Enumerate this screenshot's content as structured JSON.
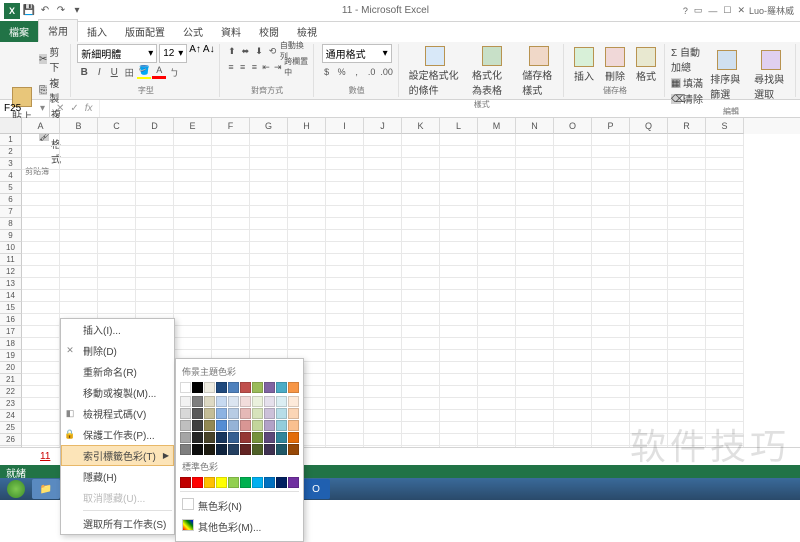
{
  "title": "11 - Microsoft Excel",
  "user": "Luo-羅林威",
  "qat": {
    "save": "H"
  },
  "tabs": {
    "file": "檔案",
    "list": [
      "常用",
      "插入",
      "版面配置",
      "公式",
      "資料",
      "校閱",
      "檢視"
    ],
    "active": 0
  },
  "ribbon": {
    "clipboard": {
      "paste": "貼上",
      "cut": "剪下",
      "copy": "複製",
      "fmtpaint": "複製格式",
      "label": "剪貼簿"
    },
    "font": {
      "name": "新細明體",
      "size": "12",
      "label": "字型"
    },
    "align": {
      "wrap": "自動換列",
      "merge": "跨欄置中",
      "label": "對齊方式"
    },
    "number": {
      "format": "通用格式",
      "label": "數值"
    },
    "styles": {
      "cond": "設定格式化的條件",
      "fmttbl": "格式化為表格",
      "cellstyle": "儲存格樣式",
      "label": "樣式"
    },
    "cells": {
      "insert": "插入",
      "delete": "刪除",
      "format": "格式",
      "label": "儲存格"
    },
    "editing": {
      "autosum": "Σ 自動加總",
      "fill": "填滿",
      "clear": "清除",
      "sort": "排序與篩選",
      "find": "尋找與選取",
      "label": "編輯"
    }
  },
  "namebox": "F25",
  "fx": "fx",
  "columns": [
    "A",
    "B",
    "C",
    "D",
    "E",
    "F",
    "G",
    "H",
    "I",
    "J",
    "K",
    "L",
    "M",
    "N",
    "O",
    "P",
    "Q",
    "R",
    "S"
  ],
  "rows": 27,
  "context_menu": {
    "items": [
      {
        "label": "插入(I)...",
        "icon": ""
      },
      {
        "label": "刪除(D)",
        "icon": "✕"
      },
      {
        "label": "重新命名(R)",
        "icon": ""
      },
      {
        "label": "移動或複製(M)...",
        "icon": ""
      },
      {
        "label": "檢視程式碼(V)",
        "icon": "◧"
      },
      {
        "label": "保護工作表(P)...",
        "icon": "🔒"
      },
      {
        "label": "索引標籤色彩(T)",
        "icon": "",
        "arrow": true,
        "hover": true
      },
      {
        "label": "隱藏(H)",
        "icon": ""
      },
      {
        "label": "取消隱藏(U)...",
        "icon": "",
        "disabled": true
      },
      {
        "sep": true
      },
      {
        "label": "選取所有工作表(S)",
        "icon": ""
      }
    ]
  },
  "color_submenu": {
    "title1": "佈景主題色彩",
    "title2": "標準色彩",
    "nocolor": "無色彩(N)",
    "more": "其他色彩(M)...",
    "theme_row1": [
      "#ffffff",
      "#000000",
      "#eeece1",
      "#1f497d",
      "#4f81bd",
      "#c0504d",
      "#9bbb59",
      "#8064a2",
      "#4bacc6",
      "#f79646"
    ],
    "theme_shades": [
      [
        "#f2f2f2",
        "#7f7f7f",
        "#ddd9c3",
        "#c6d9f0",
        "#dbe5f1",
        "#f2dcdb",
        "#ebf1dd",
        "#e5e0ec",
        "#dbeef3",
        "#fdeada"
      ],
      [
        "#d8d8d8",
        "#595959",
        "#c4bd97",
        "#8db3e2",
        "#b8cce4",
        "#e5b9b7",
        "#d7e3bc",
        "#ccc1d9",
        "#b7dde8",
        "#fbd5b5"
      ],
      [
        "#bfbfbf",
        "#3f3f3f",
        "#938953",
        "#548dd4",
        "#95b3d7",
        "#d99694",
        "#c3d69b",
        "#b2a2c7",
        "#92cddc",
        "#fac08f"
      ],
      [
        "#a5a5a5",
        "#262626",
        "#494429",
        "#17365d",
        "#366092",
        "#953734",
        "#76923c",
        "#5f497a",
        "#31859b",
        "#e36c09"
      ],
      [
        "#7f7f7f",
        "#0c0c0c",
        "#1d1b10",
        "#0f243e",
        "#244061",
        "#632423",
        "#4f6128",
        "#3f3151",
        "#205867",
        "#974806"
      ]
    ],
    "standard": [
      "#c00000",
      "#ff0000",
      "#ffc000",
      "#ffff00",
      "#92d050",
      "#00b050",
      "#00b0f0",
      "#0070c0",
      "#002060",
      "#7030a0"
    ]
  },
  "sheet": "11",
  "status": "就緒",
  "watermark": "软件技巧"
}
